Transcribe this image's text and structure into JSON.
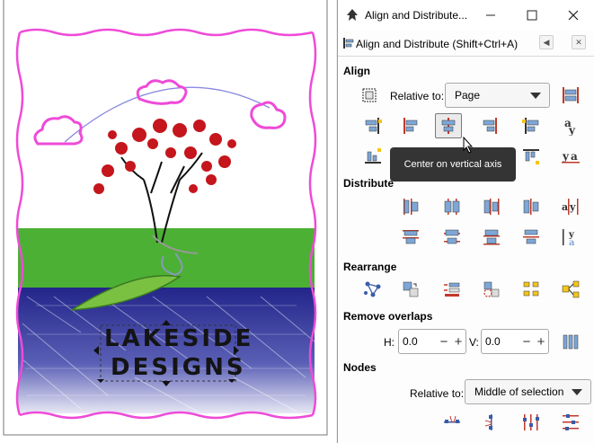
{
  "canvas": {
    "logo_line1": "LAKESIDE",
    "logo_line2": "DESIGNS",
    "colors": {
      "grass": "#4caf35",
      "water": "#2b2f8f",
      "frame": "#ef4ad8",
      "leaves": "#c4161c"
    }
  },
  "dialog": {
    "window_title": "Align and Distribute...",
    "header_label": "Align and Distribute (Shift+Ctrl+A)",
    "sections": {
      "align": "Align",
      "distribute": "Distribute",
      "rearrange": "Rearrange",
      "remove_overlaps": "Remove overlaps",
      "nodes": "Nodes"
    },
    "relative_to_label": "Relative to:",
    "relative_to_value": "Page",
    "h_label": "H:",
    "h_value": "0.0",
    "v_label": "V:",
    "v_value": "0.0",
    "nodes_relative_label": "Relative to:",
    "nodes_relative_value": "Middle of selection",
    "tooltip": "Center on vertical axis",
    "icons": [
      "inkscape-icon",
      "minimize-icon",
      "maximize-icon",
      "close-icon",
      "align-distribute-icon",
      "dock-icon",
      "close-panel-icon"
    ]
  }
}
